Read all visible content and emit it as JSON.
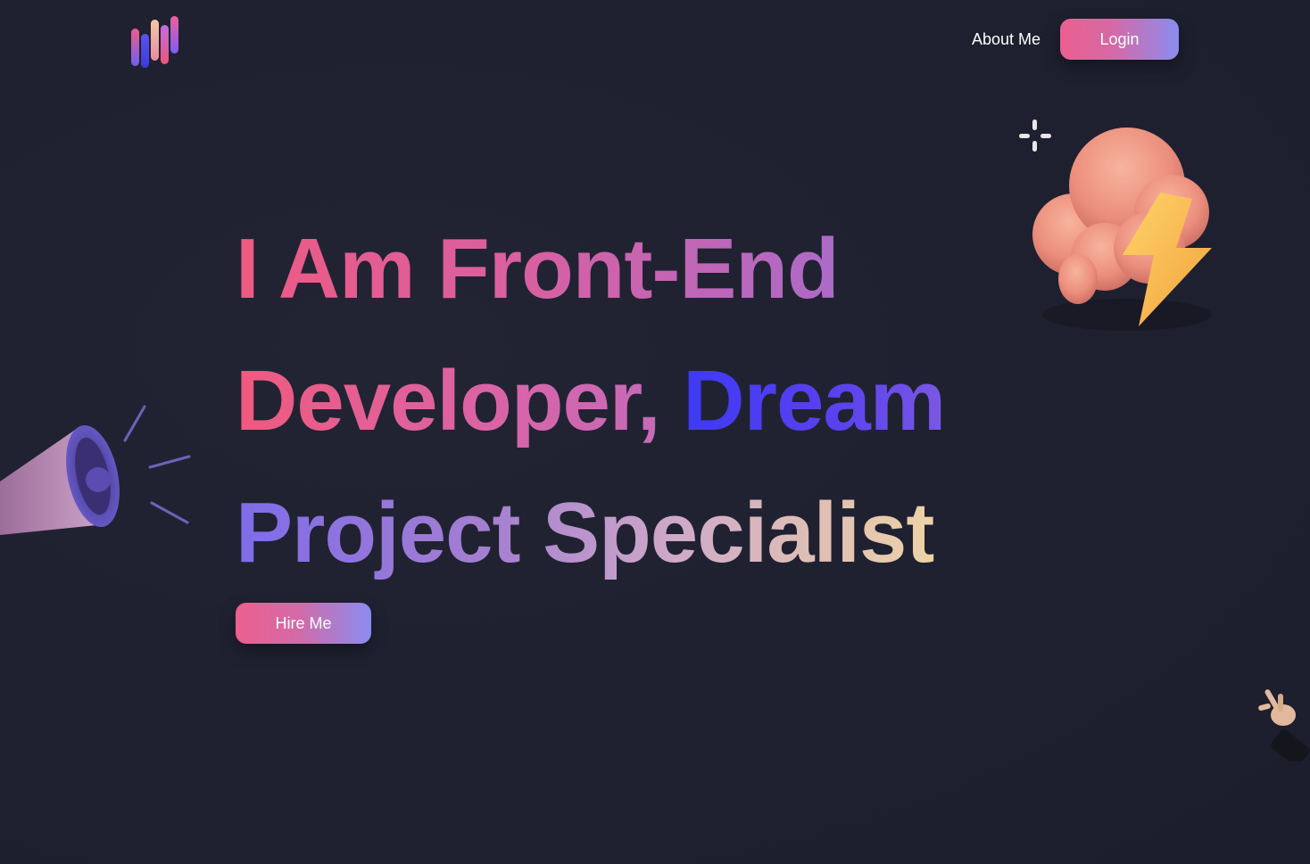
{
  "header": {
    "logo_icon": "bars-logo-icon",
    "nav": {
      "about_label": "About Me",
      "login_label": "Login"
    }
  },
  "hero": {
    "line1": "I Am Front-End",
    "line2_part1": "Developer, ",
    "line2_part2": "Dream",
    "line3": "Project Specialist",
    "cta_label": "Hire Me"
  },
  "decorations": {
    "cloud": "storm-cloud-icon",
    "sparkle": "sparkle-icon",
    "megaphone": "megaphone-icon",
    "hand": "rock-hand-icon"
  },
  "colors": {
    "background": "#1f2130",
    "accent_pink": "#ec5f8f",
    "accent_violet": "#8a8cf0",
    "accent_blue": "#3e39f5",
    "accent_gold": "#f1d7a2"
  }
}
